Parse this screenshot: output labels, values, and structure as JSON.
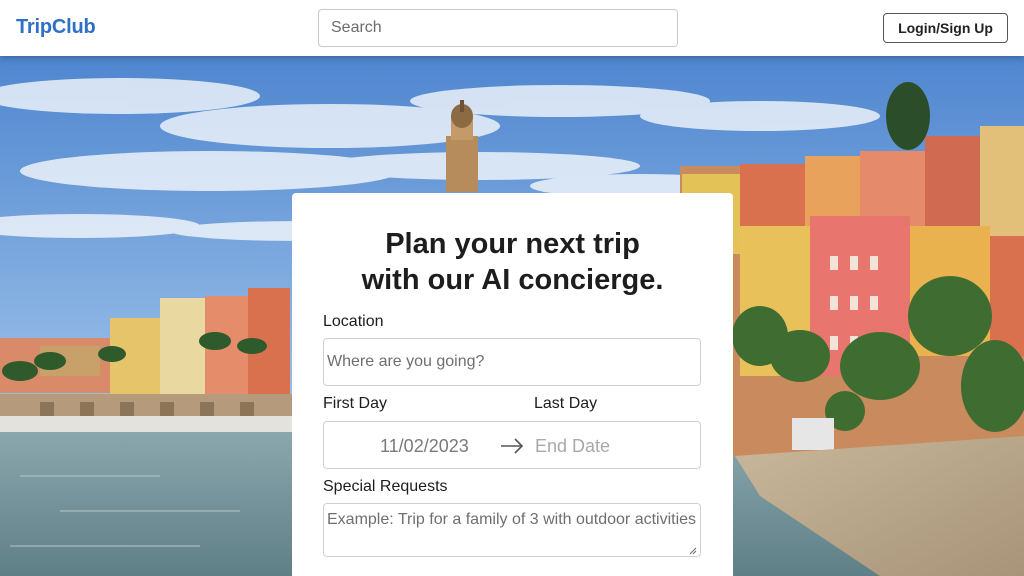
{
  "header": {
    "brand": "TripClub",
    "search_placeholder": "Search",
    "login_label": "Login/Sign Up"
  },
  "form": {
    "heading_line1": "Plan your next trip",
    "heading_line2": "with our AI concierge.",
    "location_label": "Location",
    "location_placeholder": "Where are you going?",
    "first_day_label": "First Day",
    "last_day_label": "Last Day",
    "start_date": "11/02/2023",
    "end_date_placeholder": "End Date",
    "requests_label": "Special Requests",
    "requests_placeholder": "Example: Trip for a family of 3 with outdoor activities"
  },
  "icons": {
    "date_separator": "arrow-right-icon",
    "resize": "resize-grip-icon"
  },
  "colors": {
    "brand": "#2f6fc6",
    "sky": "#6f9fd6",
    "water": "#7d9a9e",
    "text": "#1d1d1d"
  }
}
